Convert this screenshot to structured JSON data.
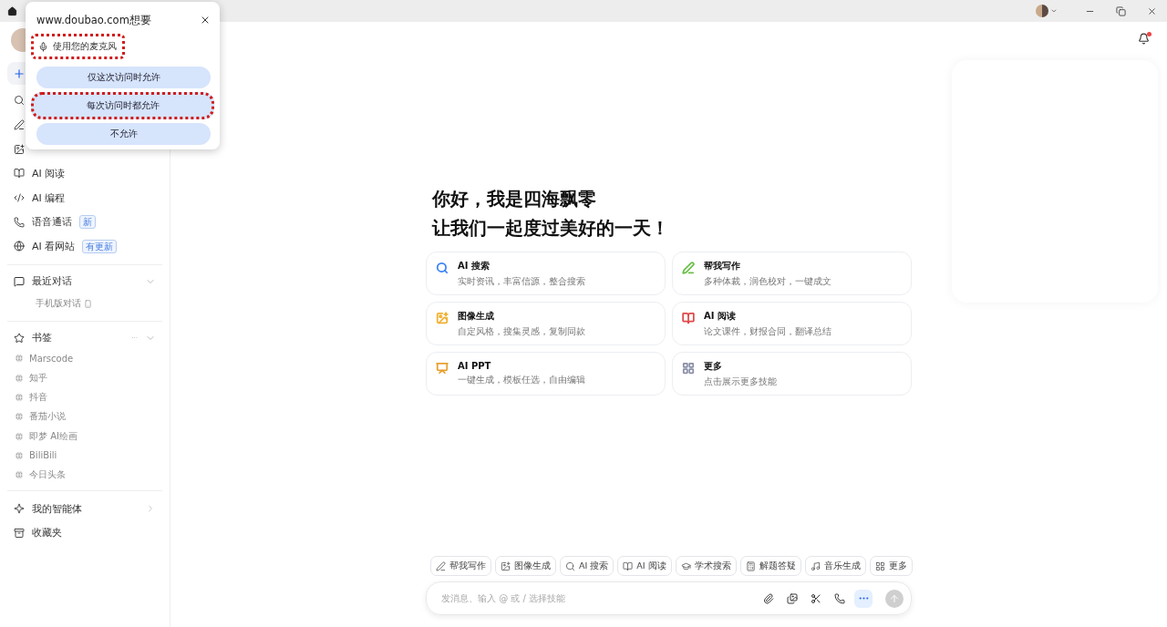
{
  "titlebar": {
    "controls": [
      {
        "kind": "minimize"
      },
      {
        "kind": "restore"
      },
      {
        "kind": "close"
      }
    ]
  },
  "sidebar": {
    "nav": [
      {
        "kind": "search"
      },
      {
        "kind": "write"
      },
      {
        "kind": "image"
      },
      {
        "kind": "read",
        "label": "AI 阅读"
      },
      {
        "kind": "code",
        "label": "AI 编程"
      },
      {
        "kind": "phone",
        "label": "语音通话",
        "badge": "新"
      },
      {
        "kind": "web",
        "label": "AI 看网站",
        "badge": "有更新"
      }
    ],
    "recent": {
      "title": "最近对话",
      "items": [
        "手机版对话"
      ]
    },
    "bookmarks": {
      "title": "书签",
      "more": "···",
      "items": [
        "Marscode",
        "知乎",
        "抖音",
        "番茄小说",
        "即梦 AI绘画",
        "BiliBili",
        "今日头条"
      ]
    },
    "footer": [
      {
        "kind": "agent",
        "label": "我的智能体"
      },
      {
        "kind": "archive",
        "label": "收藏夹"
      }
    ]
  },
  "popup": {
    "title": "www.doubao.com想要",
    "permission": {
      "label": "使用您的麦克风",
      "highlighted": true
    },
    "buttons": [
      {
        "label": "仅这次访问时允许",
        "highlighted": false
      },
      {
        "label": "每次访问时都允许",
        "highlighted": true
      },
      {
        "label": "不允许",
        "highlighted": false
      }
    ]
  },
  "greeting": [
    "你好，我是四海飘零",
    "让我们一起度过美好的一天！"
  ],
  "cards": [
    {
      "kind": "search",
      "title": "AI 搜索",
      "desc": "实时资讯，丰富信源，整合搜索",
      "color": "#3b82f6"
    },
    {
      "kind": "write",
      "title": "帮我写作",
      "desc": "多种体裁，润色校对，一键成文",
      "color": "#6cc04a"
    },
    {
      "kind": "image",
      "title": "图像生成",
      "desc": "自定风格，搜集灵感，复制同款",
      "color": "#f0b030"
    },
    {
      "kind": "read",
      "title": "AI 阅读",
      "desc": "论文课件，财报合同，翻译总结",
      "color": "#e04848"
    },
    {
      "kind": "ppt",
      "title": "AI PPT",
      "desc": "一键生成，模板任选，自由编辑",
      "color": "#e8a030"
    },
    {
      "kind": "more",
      "title": "更多",
      "desc": "点击展示更多技能",
      "color": "#8a8fa8"
    }
  ],
  "chips": [
    {
      "kind": "write",
      "label": "帮我写作"
    },
    {
      "kind": "image",
      "label": "图像生成"
    },
    {
      "kind": "search",
      "label": "AI 搜索"
    },
    {
      "kind": "read",
      "label": "AI 阅读"
    },
    {
      "kind": "academic",
      "label": "学术搜索"
    },
    {
      "kind": "solve",
      "label": "解题答疑"
    },
    {
      "kind": "music",
      "label": "音乐生成"
    },
    {
      "kind": "more",
      "label": "更多"
    }
  ],
  "composer": {
    "placeholder": "发消息、输入 @ 或 / 选择技能",
    "tools": [
      {
        "kind": "attach",
        "active": false
      },
      {
        "kind": "images",
        "active": false
      },
      {
        "kind": "cut",
        "active": false
      },
      {
        "kind": "phone",
        "active": false
      },
      {
        "kind": "more",
        "active": true
      }
    ],
    "send": {
      "disabled": true
    }
  }
}
